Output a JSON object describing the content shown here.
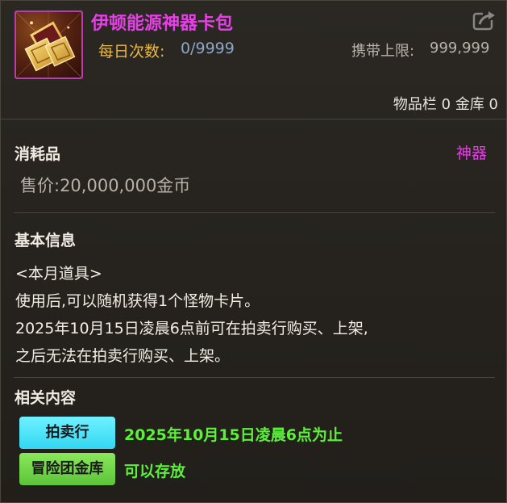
{
  "item": {
    "name": "伊顿能源神器卡包",
    "icon": "card-pack-icon",
    "daily_label": "每日次数:",
    "daily_value": "0/9999",
    "carry_label": "携带上限:",
    "carry_value": "999,999",
    "inventory_text": "物品栏 0 金库 0"
  },
  "consumable": {
    "title": "消耗品",
    "category": "神器",
    "price": "售价:20,000,000金币"
  },
  "basic_info": {
    "title": "基本信息",
    "lines": [
      "<本月道具>",
      "使用后,可以随机获得1个怪物卡片。",
      "2025年10月15日凌晨6点前可在拍卖行购买、上架,",
      "之后无法在拍卖行购买、上架。"
    ]
  },
  "related": {
    "title": "相关内容",
    "items": [
      {
        "label": "拍卖行",
        "desc": "2025年10月15日凌晨6点为止"
      },
      {
        "label": "冒险团金库",
        "desc": "可以存放"
      }
    ]
  },
  "colors": {
    "title_magenta": "#e540e5",
    "daily_gold": "#e8b84a",
    "auction_cyan": "#33d7f2",
    "storage_green": "#5cc43a",
    "desc_green": "#5cf03a"
  }
}
